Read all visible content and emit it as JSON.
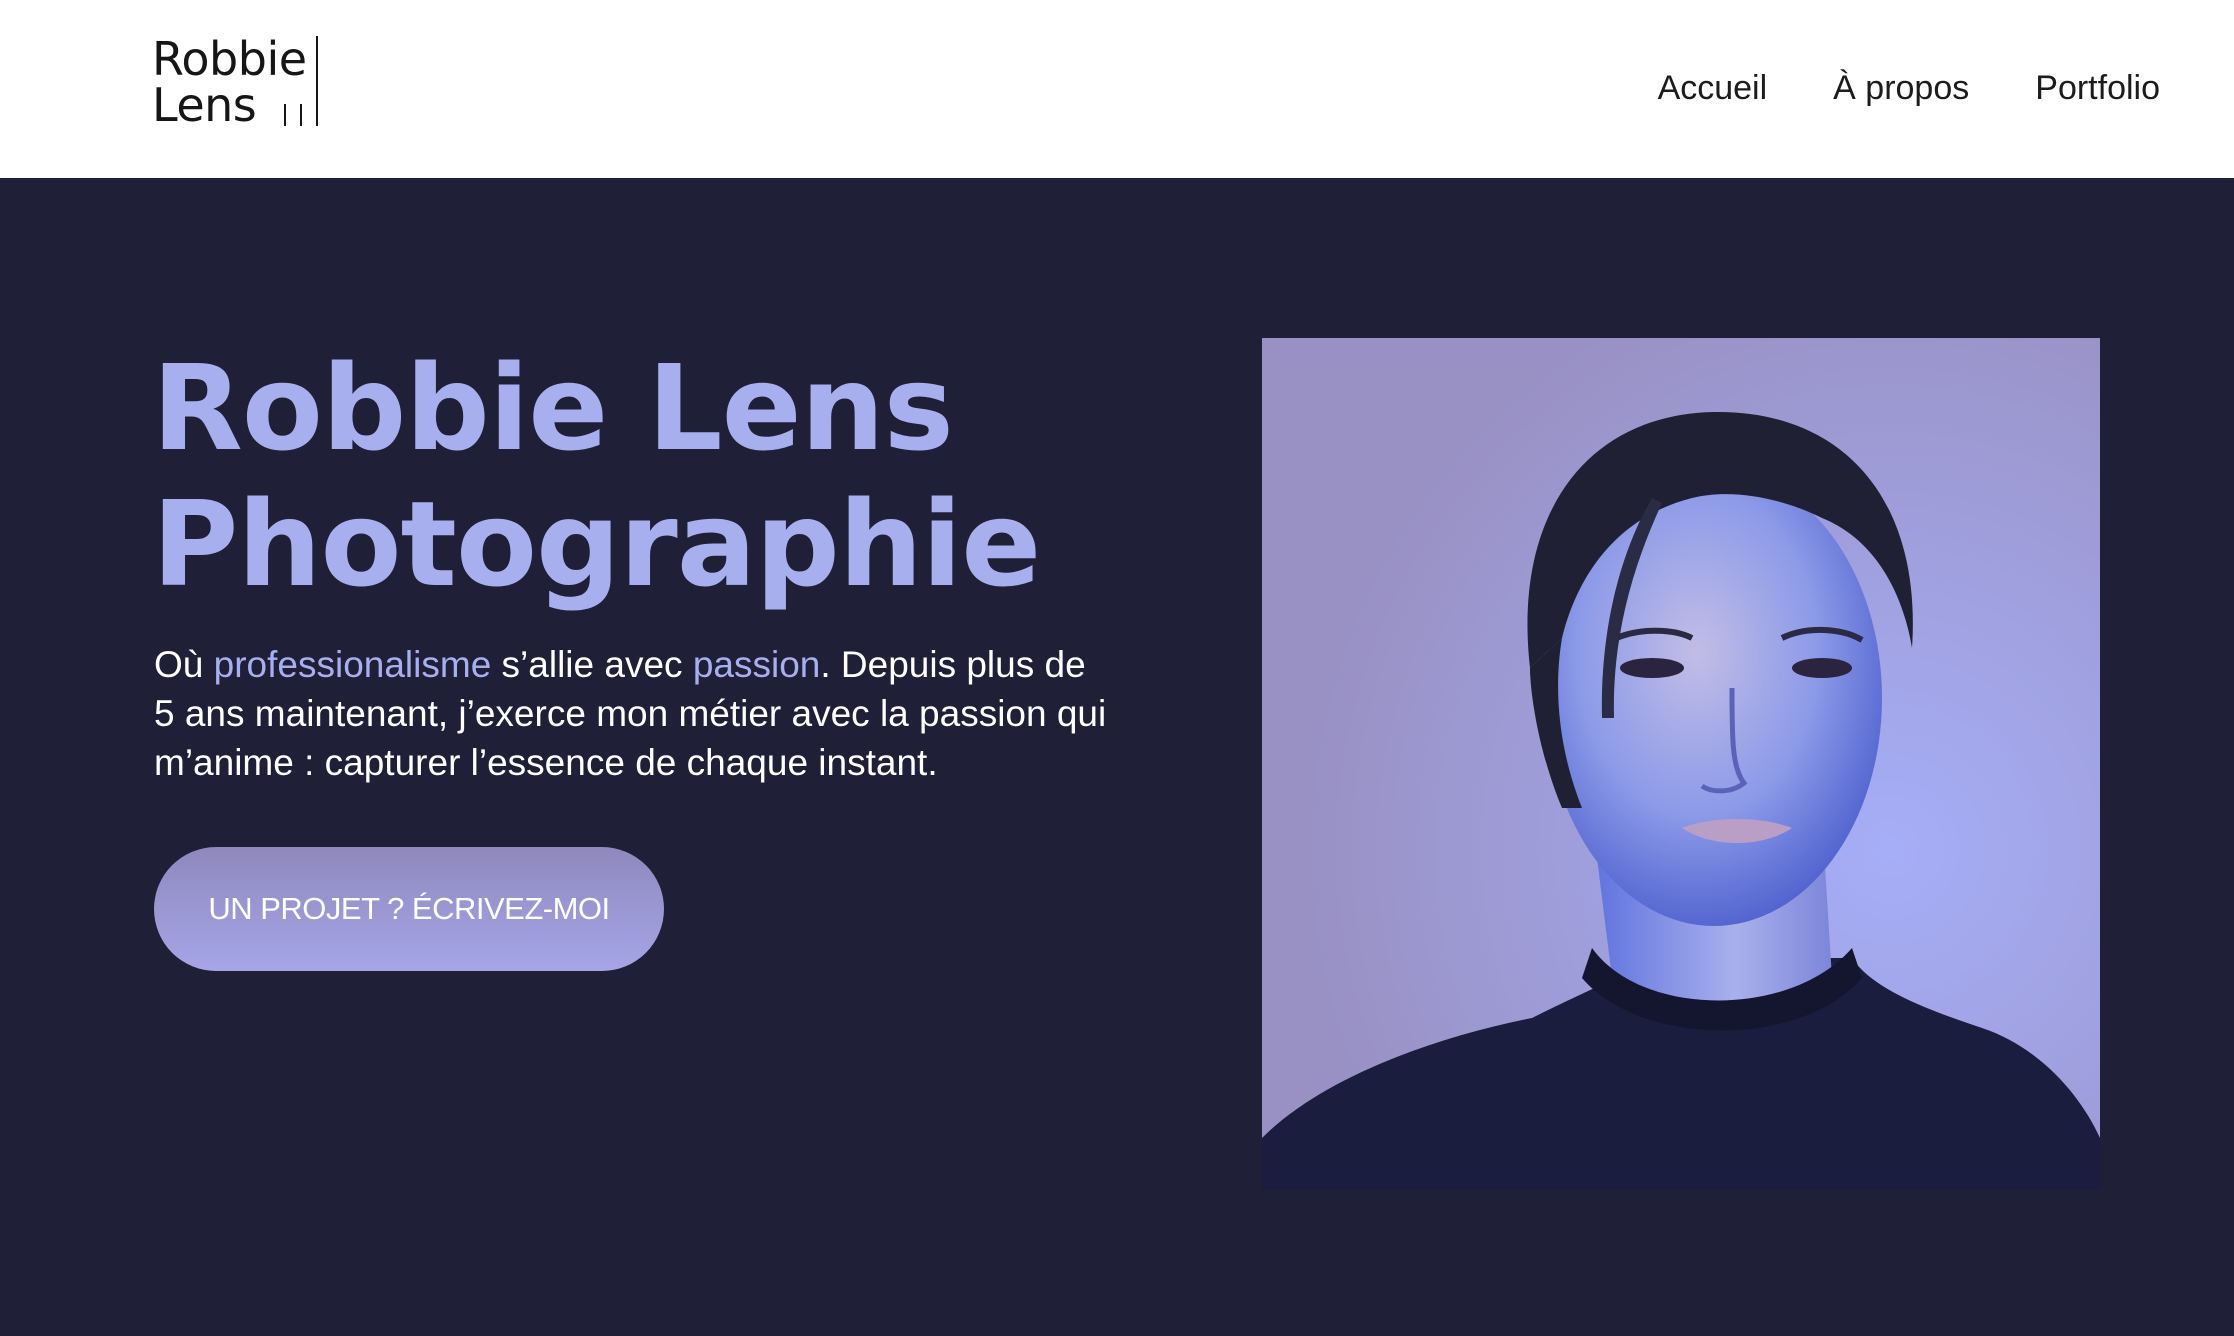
{
  "brand": {
    "logo_line1": "Robbie",
    "logo_line2": "Lens"
  },
  "nav": {
    "items": [
      "Accueil",
      "À propos",
      "Portfolio"
    ]
  },
  "hero": {
    "title_line1": "Robbie Lens",
    "title_line2": "Photographie",
    "text": {
      "part1": "Où ",
      "accent1": "professionalisme",
      "part2": " s’allie avec ",
      "accent2": "passion",
      "part3": ". Depuis plus de 5 ans maintenant, j’exerce mon métier avec la passion qui m’anime : capturer l’essence de chaque instant."
    },
    "cta_label": "UN PROJET ? ÉCRIVEZ-MOI"
  },
  "colors": {
    "header_bg": "#ffffff",
    "hero_bg": "#1f1f37",
    "accent": "#a7afee",
    "button_gradient_top": "#8f88bd",
    "button_gradient_bottom": "#a5a6e6",
    "text_dark": "#1c1c1c",
    "text_light": "#ffffff"
  }
}
